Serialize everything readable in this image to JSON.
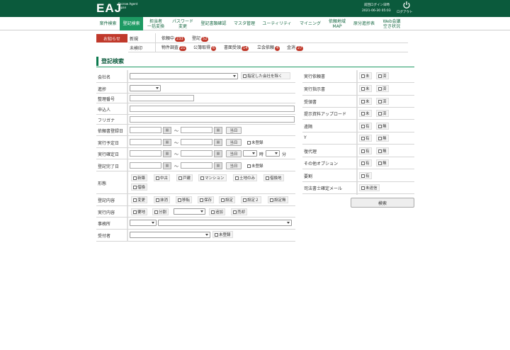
{
  "header": {
    "logo": "EAJ",
    "logo_sub": "Escrow Agent Japan",
    "login_label": "前回ログイン日時",
    "login_time": "2021-06-30 05:03",
    "logout": "ログアウト"
  },
  "nav": [
    {
      "label": "案件検索"
    },
    {
      "label": "登記検索"
    },
    {
      "label": "担当者\n一括変換"
    },
    {
      "label": "パスワード\n変更"
    },
    {
      "label": "登記書類確認"
    },
    {
      "label": "マスタ管理"
    },
    {
      "label": "ユーティリティ"
    },
    {
      "label": "マイニング"
    },
    {
      "label": "依頼地域\nMAP"
    },
    {
      "label": "原分進捗表"
    },
    {
      "label": "Web会議\n空き状況"
    }
  ],
  "notice": {
    "label": "お知らせ",
    "row1_label": "新規",
    "row2_label": "未検印",
    "row1": [
      {
        "label": "依頼中",
        "count": "233"
      },
      {
        "label": "登記",
        "count": "52"
      }
    ],
    "row2": [
      {
        "label": "物件調査",
        "count": "21"
      },
      {
        "label": "公簿取得",
        "count": "6"
      },
      {
        "label": "書面受領",
        "count": "14"
      },
      {
        "label": "立会依頼",
        "count": "4"
      },
      {
        "label": "金消",
        "count": "27"
      }
    ]
  },
  "title": "登記検索",
  "form": {
    "company": "会社名",
    "exclude_company": "指定した会社を除く",
    "progress": "進捗",
    "ref_no": "整理番号",
    "applicant": "申込人",
    "furigana": "フリガナ",
    "request_date": "依頼書登録日",
    "planned_date": "実行予定日",
    "confirmed_date": "実行確定日",
    "completed_date": "登記完了日",
    "property": "形態",
    "reg_content": "登記内容",
    "exec_content": "実行内容",
    "office": "事務所",
    "receiver": "受付者",
    "tilde": "〜",
    "today": "当日",
    "unregistered": "未登録",
    "hour": "時",
    "minute": "分",
    "property_opts": [
      "新築",
      "中古",
      "戸建",
      "マンション",
      "土地のみ",
      "借換地",
      "借換"
    ],
    "reg_opts": [
      "変更",
      "抹消",
      "移転",
      "保存",
      "設定",
      "設定２",
      "設定無"
    ],
    "exec_opts": [
      "要地",
      "分割",
      "追加",
      "売却"
    ]
  },
  "right": {
    "rows": [
      {
        "label": "実行依頼書",
        "a": "未",
        "b": "済"
      },
      {
        "label": "実行指示書",
        "a": "未",
        "b": "済"
      },
      {
        "label": "受領書",
        "a": "未",
        "b": "済"
      },
      {
        "label": "提示資料アップロード",
        "a": "未",
        "b": "済"
      },
      {
        "label": "遠隔",
        "a": "有",
        "b": "無"
      },
      {
        "label": "Y",
        "a": "有",
        "b": "無"
      },
      {
        "label": "復代理",
        "a": "有",
        "b": "無"
      },
      {
        "label": "その他オプション",
        "a": "有",
        "b": "無"
      },
      {
        "label": "要割",
        "a": "有",
        "b": ""
      },
      {
        "label": "司法書士確定メール",
        "a": "未送信",
        "b": ""
      }
    ],
    "search_label": "検索"
  }
}
